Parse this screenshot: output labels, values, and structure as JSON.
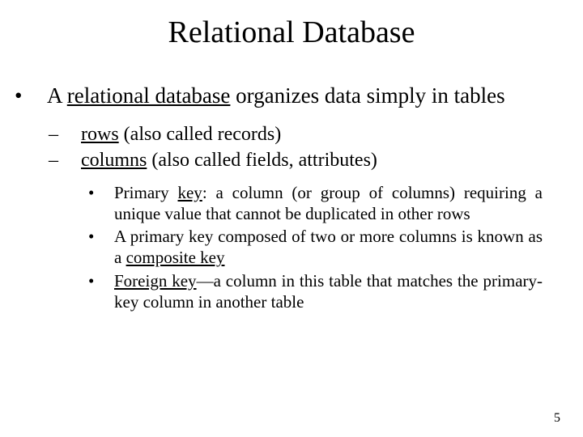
{
  "title": "Relational Database",
  "bullet1": {
    "marker": "•",
    "pre": "A ",
    "u": "relational database",
    "post": " organizes data simply in tables"
  },
  "sub1": {
    "marker": "–",
    "u": "rows",
    "post": " (also called records)"
  },
  "sub2": {
    "marker": "–",
    "u": "columns",
    "post": " (also called fields, attributes)"
  },
  "subsub1": {
    "marker": "•",
    "pre": "Primary ",
    "u": "key",
    "post": ": a column (or group of columns) requiring a unique value that cannot be duplicated in other rows"
  },
  "subsub2": {
    "marker": "•",
    "pre": "A primary key composed of two or more columns is known as a ",
    "u": "composite key"
  },
  "subsub3": {
    "marker": "•",
    "u": "Foreign key",
    "post": "—a column in this table that matches the primary-key column in another table"
  },
  "pageNumber": "5"
}
